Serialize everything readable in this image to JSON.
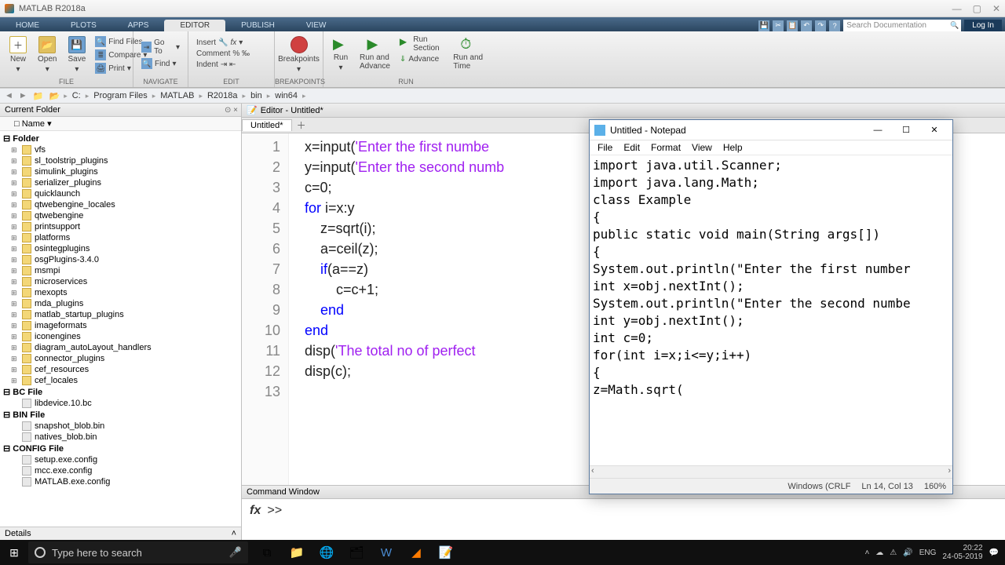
{
  "titlebar": {
    "title": "MATLAB R2018a"
  },
  "tabs": [
    "HOME",
    "PLOTS",
    "APPS",
    "EDITOR",
    "PUBLISH",
    "VIEW"
  ],
  "active_tab": "EDITOR",
  "search_placeholder": "Search Documentation",
  "login": "Log In",
  "ribbon": {
    "file": {
      "new": "New",
      "open": "Open",
      "save": "Save",
      "findfiles": "Find Files",
      "compare": "Compare",
      "print": "Print",
      "label": "FILE"
    },
    "navigate": {
      "goto": "Go To",
      "find": "Find",
      "label": "NAVIGATE"
    },
    "edit": {
      "insert": "Insert",
      "comment": "Comment",
      "indent": "Indent",
      "label": "EDIT"
    },
    "breakpoints": {
      "label": "BREAKPOINTS",
      "btn": "Breakpoints"
    },
    "run": {
      "run": "Run",
      "runadv": "Run and\nAdvance",
      "runsec": "Run Section",
      "advance": "Advance",
      "runtime": "Run and\nTime",
      "label": "RUN"
    }
  },
  "breadcrumbs": [
    "C:",
    "Program Files",
    "MATLAB",
    "R2018a",
    "bin",
    "win64"
  ],
  "currentfolder": {
    "title": "Current Folder",
    "colhead": "Name",
    "groups": [
      {
        "name": "Folder",
        "items": [
          "vfs",
          "sl_toolstrip_plugins",
          "simulink_plugins",
          "serializer_plugins",
          "quicklaunch",
          "qtwebengine_locales",
          "qtwebengine",
          "printsupport",
          "platforms",
          "osintegplugins",
          "osgPlugins-3.4.0",
          "msmpi",
          "microservices",
          "mexopts",
          "mda_plugins",
          "matlab_startup_plugins",
          "imageformats",
          "iconengines",
          "diagram_autoLayout_handlers",
          "connector_plugins",
          "cef_resources",
          "cef_locales"
        ]
      },
      {
        "name": "BC File",
        "items_files": [
          "libdevice.10.bc"
        ]
      },
      {
        "name": "BIN File",
        "items_files": [
          "snapshot_blob.bin",
          "natives_blob.bin"
        ]
      },
      {
        "name": "CONFIG File",
        "items_files": [
          "setup.exe.config",
          "mcc.exe.config",
          "MATLAB.exe.config"
        ]
      }
    ],
    "details": "Details"
  },
  "editor": {
    "title": "Editor - Untitled*",
    "tab": "Untitled*",
    "lines": [
      {
        "n": 1,
        "pre": "x=input(",
        "str": "'Enter the first numbe"
      },
      {
        "n": 2,
        "pre": "y=input(",
        "str": "'Enter the second numb"
      },
      {
        "n": 3,
        "plain": "c=0;"
      },
      {
        "n": 4,
        "kw": "for",
        "rest": " i=x:y"
      },
      {
        "n": 5,
        "indent": "    ",
        "plain": "z=sqrt(i);"
      },
      {
        "n": 6,
        "indent": "    ",
        "plain": "a=ceil(z);"
      },
      {
        "n": 7,
        "indent": "    ",
        "kw": "if",
        "rest": "(a==z)"
      },
      {
        "n": 8,
        "indent": "        ",
        "plain": "c=c+1;"
      },
      {
        "n": 9,
        "indent": "    ",
        "kw": "end"
      },
      {
        "n": 10,
        "kw": "end"
      },
      {
        "n": 11,
        "pre": "disp(",
        "str": "'The total no of perfect"
      },
      {
        "n": 12,
        "plain": "disp(c);"
      },
      {
        "n": 13,
        "plain": ""
      }
    ]
  },
  "cmdwin": {
    "title": "Command Window",
    "prompt": ">>"
  },
  "notepad": {
    "title": "Untitled - Notepad",
    "menu": [
      "File",
      "Edit",
      "Format",
      "View",
      "Help"
    ],
    "text": "import java.util.Scanner;\nimport java.lang.Math;\nclass Example\n{\npublic static void main(String args[])\n{\nSystem.out.println(\"Enter the first number\nint x=obj.nextInt();\nSystem.out.println(\"Enter the second numbe\nint y=obj.nextInt();\nint c=0;\nfor(int i=x;i<=y;i++)\n{\nz=Math.sqrt(",
    "status": {
      "enc": "Windows (CRLF",
      "pos": "Ln 14, Col 13",
      "zoom": "160%"
    }
  },
  "taskbar": {
    "search": "Type here to search",
    "time": "20:22",
    "date": "24-05-2019"
  }
}
